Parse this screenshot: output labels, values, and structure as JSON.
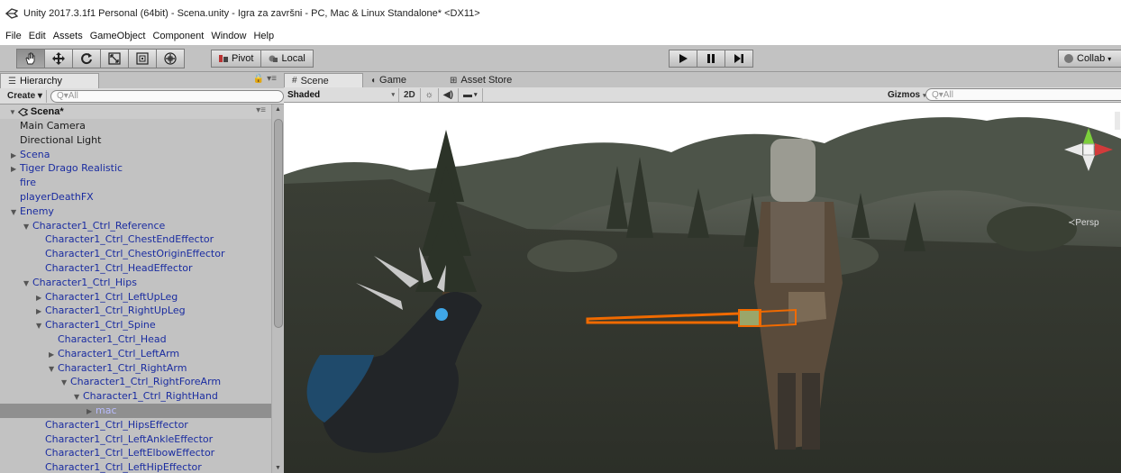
{
  "window": {
    "title": "Unity 2017.3.1f1 Personal (64bit) - Scena.unity - Igra za završni - PC, Mac & Linux Standalone* <DX11>"
  },
  "menu": [
    "File",
    "Edit",
    "Assets",
    "GameObject",
    "Component",
    "Window",
    "Help"
  ],
  "toolbar": {
    "tools": [
      "hand-tool",
      "move-tool",
      "rotate-tool",
      "scale-tool",
      "rect-tool",
      "transform-tool"
    ],
    "pivot_label": "Pivot",
    "local_label": "Local",
    "collab_label": "Collab"
  },
  "hierarchy": {
    "tab_label": "Hierarchy",
    "create_label": "Create",
    "search_placeholder": "Q▾All",
    "scene_name": "Scena*",
    "items": [
      {
        "label": "Main Camera",
        "depth": 0,
        "arrow": "",
        "blue": false
      },
      {
        "label": "Directional Light",
        "depth": 0,
        "arrow": "",
        "blue": false
      },
      {
        "label": "Scena",
        "depth": 0,
        "arrow": "right",
        "blue": true
      },
      {
        "label": "Tiger Drago Realistic",
        "depth": 0,
        "arrow": "right",
        "blue": true
      },
      {
        "label": "fire",
        "depth": 0,
        "arrow": "",
        "blue": true
      },
      {
        "label": "playerDeathFX",
        "depth": 0,
        "arrow": "",
        "blue": true
      },
      {
        "label": "Enemy",
        "depth": 0,
        "arrow": "down",
        "blue": true
      },
      {
        "label": "Character1_Ctrl_Reference",
        "depth": 1,
        "arrow": "down",
        "blue": true
      },
      {
        "label": "Character1_Ctrl_ChestEndEffector",
        "depth": 2,
        "arrow": "",
        "blue": true
      },
      {
        "label": "Character1_Ctrl_ChestOriginEffector",
        "depth": 2,
        "arrow": "",
        "blue": true
      },
      {
        "label": "Character1_Ctrl_HeadEffector",
        "depth": 2,
        "arrow": "",
        "blue": true
      },
      {
        "label": "Character1_Ctrl_Hips",
        "depth": 1,
        "arrow": "down",
        "blue": true
      },
      {
        "label": "Character1_Ctrl_LeftUpLeg",
        "depth": 2,
        "arrow": "right",
        "blue": true
      },
      {
        "label": "Character1_Ctrl_RightUpLeg",
        "depth": 2,
        "arrow": "right",
        "blue": true
      },
      {
        "label": "Character1_Ctrl_Spine",
        "depth": 2,
        "arrow": "down",
        "blue": true
      },
      {
        "label": "Character1_Ctrl_Head",
        "depth": 3,
        "arrow": "",
        "blue": true
      },
      {
        "label": "Character1_Ctrl_LeftArm",
        "depth": 3,
        "arrow": "right",
        "blue": true
      },
      {
        "label": "Character1_Ctrl_RightArm",
        "depth": 3,
        "arrow": "down",
        "blue": true
      },
      {
        "label": "Character1_Ctrl_RightForeArm",
        "depth": 4,
        "arrow": "down",
        "blue": true
      },
      {
        "label": "Character1_Ctrl_RightHand",
        "depth": 5,
        "arrow": "down",
        "blue": true
      },
      {
        "label": "mac",
        "depth": 6,
        "arrow": "right",
        "blue": true,
        "selected": true
      },
      {
        "label": "Character1_Ctrl_HipsEffector",
        "depth": 2,
        "arrow": "",
        "blue": true
      },
      {
        "label": "Character1_Ctrl_LeftAnkleEffector",
        "depth": 2,
        "arrow": "",
        "blue": true
      },
      {
        "label": "Character1_Ctrl_LeftElbowEffector",
        "depth": 2,
        "arrow": "",
        "blue": true
      },
      {
        "label": "Character1_Ctrl_LeftHipEffector",
        "depth": 2,
        "arrow": "",
        "blue": true
      }
    ]
  },
  "scene": {
    "tabs": [
      {
        "label": "Scene",
        "icon": "#",
        "active": true
      },
      {
        "label": "Game",
        "icon": "◖",
        "active": false
      },
      {
        "label": "Asset Store",
        "icon": "⊞",
        "active": false
      }
    ],
    "shading_mode": "Shaded",
    "mode_2d": "2D",
    "gizmos_label": "Gizmos",
    "search_placeholder": "Q▾All",
    "persp_label": "≺Persp",
    "colors": {
      "sky": "#ffffff",
      "ground": "#33372f",
      "selection_outline": "#f06a00"
    }
  }
}
